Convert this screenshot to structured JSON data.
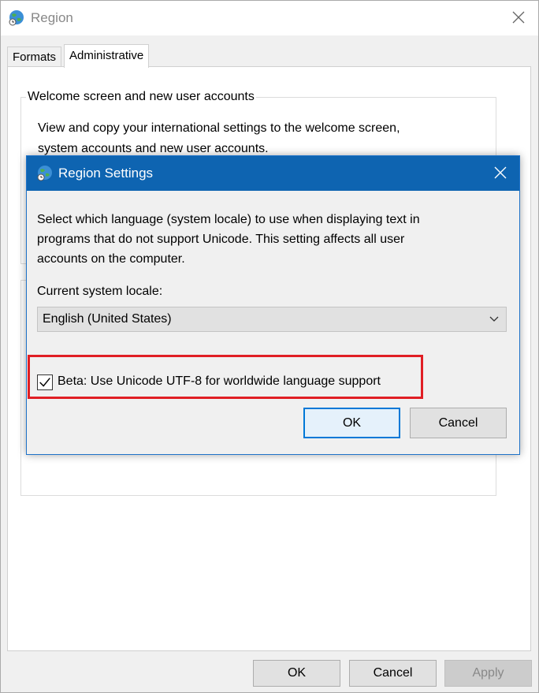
{
  "window": {
    "title": "Region"
  },
  "tabs": [
    "Formats",
    "Administrative"
  ],
  "welcome_group": {
    "legend": "Welcome screen and new user accounts",
    "line1": "View and copy your international settings to the welcome screen,",
    "line2": "system accounts and new user accounts."
  },
  "dialog": {
    "title": "Region Settings",
    "desc1": "Select which language (system locale) to use when displaying text in",
    "desc2": "programs that do not support Unicode. This setting affects all user",
    "desc3": "accounts on the computer.",
    "locale_label": "Current system locale:",
    "locale_value": "English (United States)",
    "checkbox_label": "Beta: Use Unicode UTF-8 for worldwide language support",
    "checkbox_checked": true,
    "ok": "OK",
    "cancel": "Cancel"
  },
  "buttons": {
    "ok": "OK",
    "cancel": "Cancel",
    "apply": "Apply"
  },
  "colors": {
    "dialog_title_bg": "#0e64b1",
    "highlight": "#e01e24",
    "focus_border": "#0078d7"
  }
}
